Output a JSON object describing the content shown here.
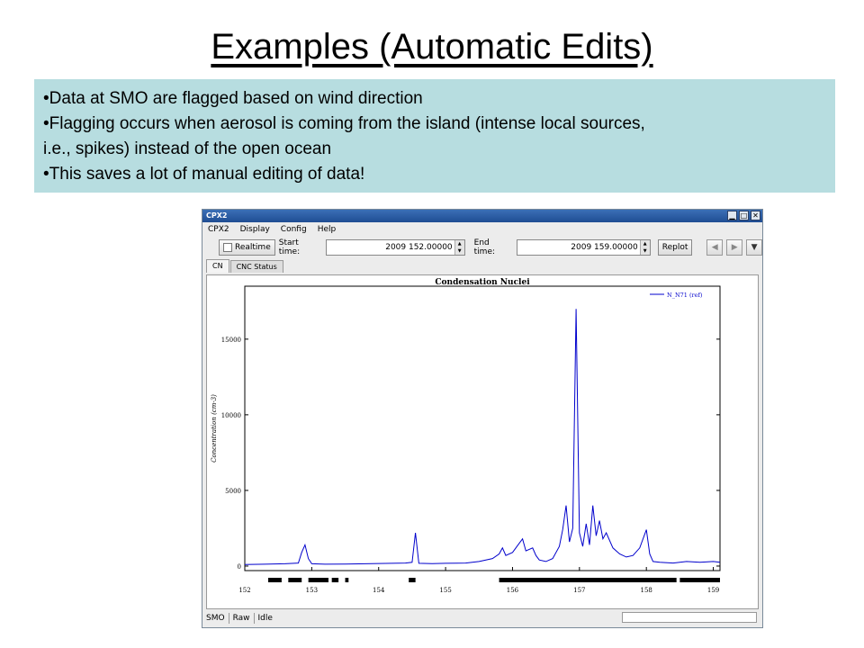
{
  "slide": {
    "title": "Examples (Automatic Edits)",
    "bullets": [
      "•Data at SMO are flagged based on wind direction",
      "•Flagging occurs when aerosol is coming from the island (intense local sources,",
      "i.e., spikes) instead of the open ocean",
      "•This saves a lot of manual editing of data!"
    ],
    "background_color": "#b7dde0"
  },
  "window": {
    "title": "CPX2",
    "controls": {
      "minimize": "▁",
      "maximize": "□",
      "close": "✕"
    },
    "menu": [
      "CPX2",
      "Display",
      "Config",
      "Help"
    ],
    "toolbar": {
      "realtime_label": "Realtime",
      "start_label": "Start time:",
      "start_value": "2009 152.00000",
      "end_label": "End time:",
      "end_value": "2009 159.00000",
      "replot_label": "Replot",
      "prev_icon": "chevron-left-icon",
      "next_icon": "chevron-right-icon",
      "dropdown_icon": "chevron-down-icon"
    },
    "tabs": [
      "CN",
      "CNC Status"
    ],
    "status": {
      "station": "SMO",
      "mode": "Raw",
      "state": "Idle"
    }
  },
  "chart_data": {
    "type": "line",
    "title": "Condensation Nuclei",
    "xlabel": "",
    "ylabel": "Concentration (cm-3)",
    "xlim": [
      152,
      159.1
    ],
    "ylim": [
      -300,
      18500
    ],
    "xticks": [
      152,
      153,
      154,
      155,
      156,
      157,
      158,
      159
    ],
    "yticks": [
      0,
      5000,
      10000,
      15000
    ],
    "legend": {
      "placement": "top-right",
      "entries": [
        "N_N71 (ref)"
      ]
    },
    "series": [
      {
        "name": "N_N71 (ref)",
        "color": "#0000cc",
        "x": [
          152.0,
          152.3,
          152.6,
          152.8,
          152.85,
          152.9,
          152.95,
          153.0,
          153.2,
          153.5,
          153.8,
          154.0,
          154.2,
          154.4,
          154.5,
          154.55,
          154.6,
          154.8,
          155.0,
          155.3,
          155.5,
          155.7,
          155.8,
          155.85,
          155.9,
          156.0,
          156.1,
          156.15,
          156.2,
          156.3,
          156.35,
          156.4,
          156.5,
          156.6,
          156.7,
          156.75,
          156.8,
          156.85,
          156.9,
          156.95,
          157.0,
          157.05,
          157.1,
          157.15,
          157.2,
          157.25,
          157.3,
          157.35,
          157.4,
          157.5,
          157.6,
          157.7,
          157.8,
          157.9,
          158.0,
          158.05,
          158.1,
          158.2,
          158.4,
          158.6,
          158.8,
          159.0,
          159.1
        ],
        "y": [
          100,
          120,
          150,
          200,
          900,
          1400,
          500,
          150,
          120,
          130,
          150,
          170,
          180,
          200,
          250,
          2200,
          180,
          160,
          180,
          200,
          300,
          500,
          800,
          1200,
          700,
          900,
          1500,
          1800,
          1000,
          1200,
          700,
          400,
          300,
          500,
          1300,
          2400,
          4000,
          1600,
          2500,
          17000,
          2200,
          1300,
          2800,
          1400,
          4000,
          2000,
          3000,
          1800,
          2200,
          1200,
          800,
          600,
          700,
          1200,
          2400,
          800,
          300,
          250,
          200,
          300,
          250,
          300,
          250
        ]
      }
    ],
    "flags": [
      [
        152.35,
        152.55
      ],
      [
        152.65,
        152.85
      ],
      [
        152.95,
        153.25
      ],
      [
        153.3,
        153.4
      ],
      [
        153.5,
        153.55
      ],
      [
        154.45,
        154.55
      ],
      [
        156.85,
        156.1
      ],
      [
        155.8,
        156.2
      ],
      [
        156.3,
        156.4
      ],
      [
        156.5,
        158.45
      ],
      [
        158.5,
        159.1
      ]
    ]
  }
}
